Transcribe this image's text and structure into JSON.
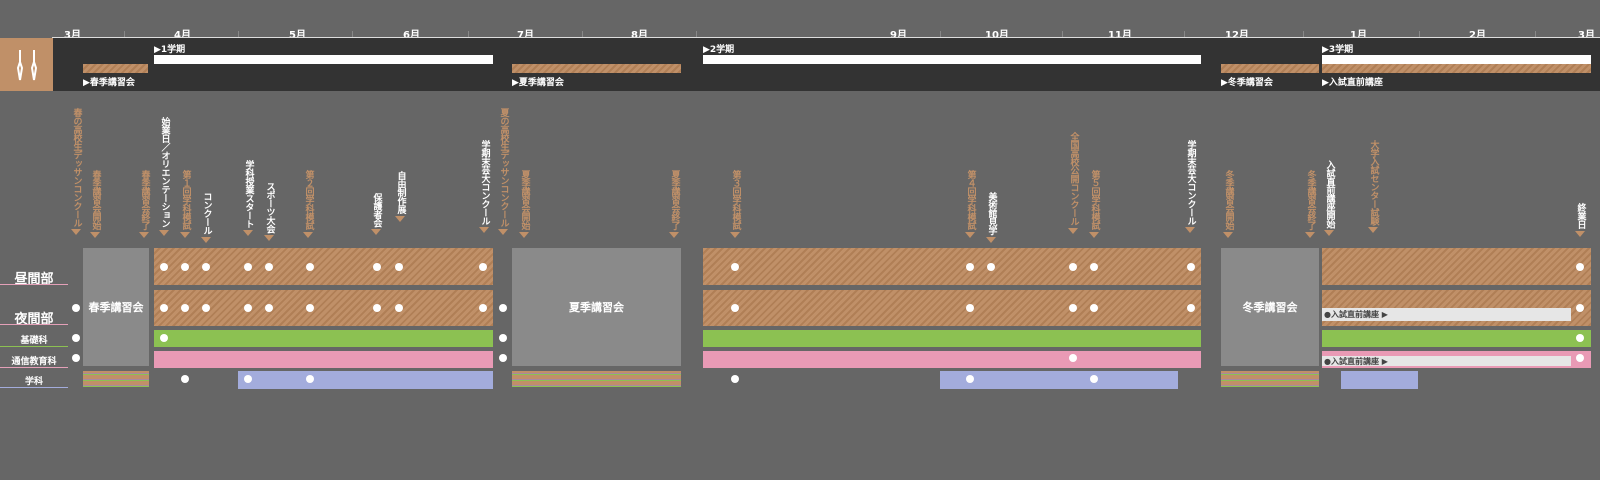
{
  "months": [
    "3月",
    "4月",
    "5月",
    "6月",
    "7月",
    "8月",
    "9月",
    "10月",
    "11月",
    "12月",
    "1月",
    "2月",
    "3月"
  ],
  "terms": {
    "first": "▶1学期",
    "second": "▶2学期",
    "third": "▶3学期"
  },
  "sessions": {
    "spring": "▶春季講習会",
    "summer": "▶夏季講習会",
    "winter": "▶冬季講習会",
    "exam_prep": "▶入試直前講座"
  },
  "events": [
    "春の高校生デッサンコンクール",
    "春季講習会開始",
    "春季講習会終了",
    "始業日／オリエンテーション",
    "第１回学科模試",
    "コンクール",
    "学科授業スタート",
    "スポーツ大会",
    "第２回学科模試",
    "保護者会",
    "自由制作展",
    "学期末芸大コンクール",
    "夏の高校生デッサンコンクール",
    "夏季講習会開始",
    "夏季講習会終了",
    "第３回学科模試",
    "第４回学科模試",
    "美術館見学",
    "全国高校公開コンクール",
    "第５回学科模試",
    "学期末芸大コンクール",
    "冬季講習会開始",
    "冬季講習会終了",
    "入試直前講座開始",
    "大学入試センター試験",
    "終業日"
  ],
  "rows": {
    "day": "昼間部",
    "night": "夜間部",
    "basic": "基礎科",
    "correspondence": "通信教育科",
    "academic": "学科"
  },
  "blocks": {
    "spring": "春季講習会",
    "summer": "夏季講習会",
    "winter": "冬季講習会"
  },
  "notes": {
    "exam_prep_night": "●入試直前講座 ▶",
    "exam_prep_corr": "●入試直前講座 ▶"
  },
  "colors": {
    "background": "#666666",
    "header": "#333333",
    "accent": "#c09068",
    "basic": "#8cc152",
    "correspondence": "#e99ab5",
    "academic": "#a3acdc",
    "session": "#8a8a8a"
  },
  "icons": {
    "logo": "pencil-brush-icon"
  }
}
